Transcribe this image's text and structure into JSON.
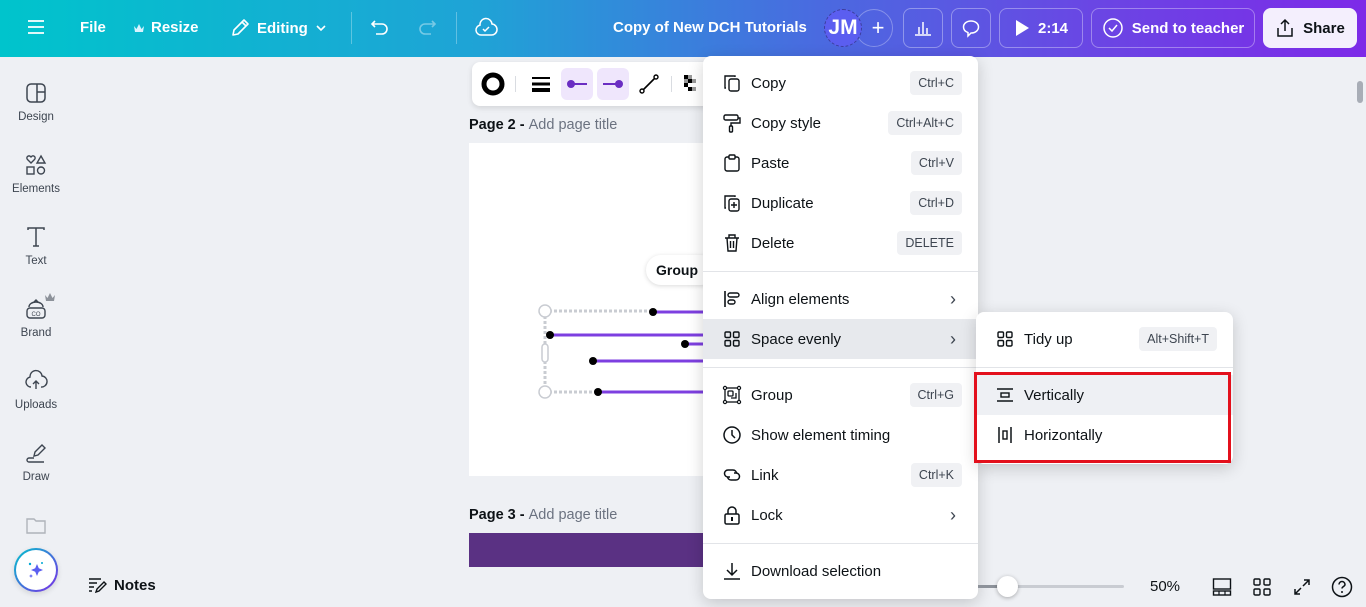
{
  "topbar": {
    "menu_icon": "hamburger-icon",
    "file_label": "File",
    "resize_label": "Resize",
    "editing_label": "Editing",
    "document_title": "Copy of New DCH Tutorials",
    "avatar_initials": "JM",
    "add_collaborator": "+",
    "play_label": "2:14",
    "send_to_teacher_label": "Send to teacher",
    "share_label": "Share",
    "gradient_start": "#00c4cc",
    "gradient_end": "#7d2ae8"
  },
  "sidebar": {
    "items": [
      {
        "label": "Design",
        "icon": "design-icon"
      },
      {
        "label": "Elements",
        "icon": "elements-icon"
      },
      {
        "label": "Text",
        "icon": "text-icon"
      },
      {
        "label": "Brand",
        "icon": "brand-icon"
      },
      {
        "label": "Uploads",
        "icon": "uploads-icon"
      },
      {
        "label": "Draw",
        "icon": "draw-icon"
      }
    ]
  },
  "canvas": {
    "page2": {
      "prefix": "Page 2 - ",
      "placeholder": "Add page title"
    },
    "page3": {
      "prefix": "Page 3 - ",
      "placeholder": "Add page title"
    },
    "group_chip": "Group",
    "line_color": "#7d3fe0",
    "page3_color": "#5a3183"
  },
  "context_menu": {
    "items": [
      {
        "label": "Copy",
        "shortcut": "Ctrl+C",
        "icon": "copy-icon"
      },
      {
        "label": "Copy style",
        "shortcut": "Ctrl+Alt+C",
        "icon": "paint-roller-icon"
      },
      {
        "label": "Paste",
        "shortcut": "Ctrl+V",
        "icon": "clipboard-icon"
      },
      {
        "label": "Duplicate",
        "shortcut": "Ctrl+D",
        "icon": "duplicate-icon"
      },
      {
        "label": "Delete",
        "shortcut": "DELETE",
        "icon": "trash-icon"
      },
      {
        "label": "Align elements",
        "icon": "align-icon",
        "submenu": true
      },
      {
        "label": "Space evenly",
        "icon": "grid-icon",
        "submenu": true,
        "highlighted": true
      },
      {
        "label": "Group",
        "shortcut": "Ctrl+G",
        "icon": "group-icon"
      },
      {
        "label": "Show element timing",
        "icon": "clock-icon"
      },
      {
        "label": "Link",
        "shortcut": "Ctrl+K",
        "icon": "link-icon"
      },
      {
        "label": "Lock",
        "icon": "lock-icon",
        "submenu": true
      },
      {
        "label": "Download selection",
        "icon": "download-icon"
      }
    ]
  },
  "submenu": {
    "items": [
      {
        "label": "Tidy up",
        "shortcut": "Alt+Shift+T",
        "icon": "tidy-up-icon"
      },
      {
        "label": "Vertically",
        "icon": "space-vertical-icon",
        "highlighted": true
      },
      {
        "label": "Horizontally",
        "icon": "space-horizontal-icon"
      }
    ],
    "annotation_color": "#e3101c"
  },
  "bottombar": {
    "notes_label": "Notes",
    "zoom_percent": "50%",
    "zoom_slider_fraction": 0.2
  }
}
